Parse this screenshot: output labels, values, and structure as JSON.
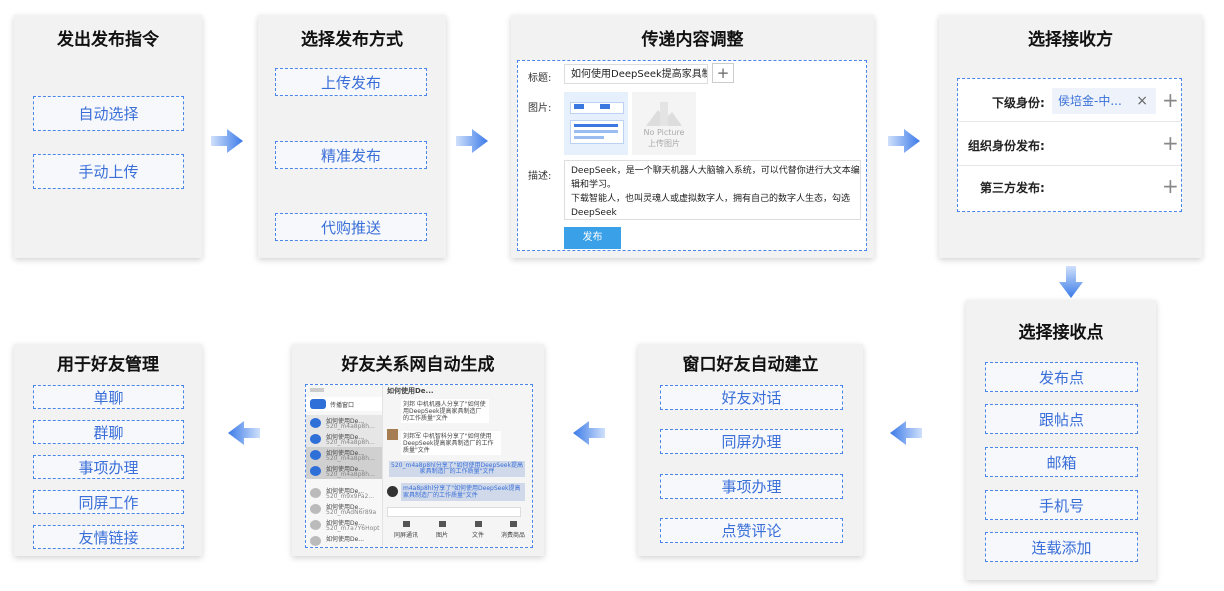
{
  "steps": {
    "s1": {
      "title": "发出发布指令",
      "options": [
        "自动选择",
        "手动上传"
      ]
    },
    "s2": {
      "title": "选择发布方式",
      "options": [
        "上传发布",
        "精准发布",
        "代购推送"
      ]
    },
    "s3": {
      "title": "传递内容调整",
      "title_label": "标题:",
      "title_value": "如何使用DeepSeek提高家具制造",
      "add_glyph": "+",
      "image_label": "图片:",
      "no_picture_en": "No Picture",
      "no_picture_cn": "上传图片",
      "desc_label": "描述:",
      "desc_line1": "DeepSeek，是一个聊天机器人大脑输入系统，可以代替你进行大文本编",
      "desc_line2": "辑和学习。",
      "desc_line3": "下载智能人，也叫灵魂人或虚拟数字人，拥有自己的数字人生态，勾选",
      "desc_line4": "DeepSeek",
      "publish_btn": "发布"
    },
    "s4": {
      "title": "选择接收方",
      "row1_label": "下级身份:",
      "row1_value": "侯培金-中...",
      "row1_close": "×",
      "row2_label": "组织身份发布:",
      "row3_label": "第三方发布:",
      "plus": "+"
    },
    "s5": {
      "title": "选择接收点",
      "options": [
        "发布点",
        "跟帖点",
        "邮箱",
        "手机号",
        "连载添加"
      ]
    },
    "s6": {
      "title": "窗口好友自动建立",
      "options": [
        "好友对话",
        "同屏办理",
        "事项办理",
        "点赞评论"
      ]
    },
    "s7": {
      "title": "好友关系网自动生成",
      "chat_header": "如何使用De...",
      "sidebar_top": "传播窗口",
      "list_items": [
        {
          "name": "如何使用De...",
          "sub": "520_m4a8p8h..."
        },
        {
          "name": "如何使用De...",
          "sub": "520_m4a8p8h..."
        },
        {
          "name": "如何使用De...",
          "sub": "520_m4a8p8h..."
        },
        {
          "name": "如何使用De...",
          "sub": "520_m4a8p8h..."
        },
        {
          "name": "如何使用De...",
          "sub": "520_m9x9Pa2..."
        },
        {
          "name": "如何使用De...",
          "sub": "520_mAdN6r89a"
        },
        {
          "name": "如何使用De...",
          "sub": "520_m7a7Y6Hopt"
        },
        {
          "name": "如何使用De...",
          "sub": ""
        }
      ],
      "msg1": "刘邦 中机机器人分享了\"如何使用DeepSeek提高家具制造厂的工作质量\"文件",
      "msg2": "刘邦军 中机智科分享了\"如何使用DeepSeek提高家具制造厂的工作质量\"文件",
      "msg3": "520_m4a8p8hl分享了\"如何使用DeepSeek提高家具制造厂的工作质量\"文件",
      "msg4": "m4a8p8hl分享了\"如何使用DeepSeek提高家具制造厂的工作质量\"文件",
      "toolbar": [
        "同屏通讯",
        "图片",
        "文件",
        "消费商品"
      ]
    },
    "s8": {
      "title": "用于好友管理",
      "options": [
        "单聊",
        "群聊",
        "事项办理",
        "同屏工作",
        "友情链接"
      ]
    }
  },
  "colors": {
    "accent": "#4a86e8",
    "card_bg": "#f2f2f2",
    "button": "#3aa0e8"
  }
}
